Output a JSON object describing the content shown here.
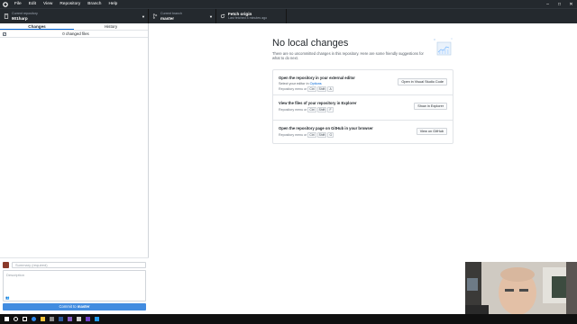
{
  "menu": {
    "items": [
      "File",
      "Edit",
      "View",
      "Repository",
      "Branch",
      "Help"
    ]
  },
  "toolbar": {
    "repo_label": "Current repository",
    "repo_value": "901harp",
    "branch_label": "Current branch",
    "branch_value": "master",
    "fetch_label": "Fetch origin",
    "fetch_sub": "Last fetched 4 minutes ago"
  },
  "sidebar": {
    "tabs": [
      "Changes",
      "History"
    ],
    "changed_files": "0 changed files",
    "summary_placeholder": "Summary (required)",
    "description_placeholder": "Description",
    "commit_prefix": "Commit to",
    "commit_branch": "master"
  },
  "main": {
    "heading": "No local changes",
    "subtext": "There are no uncommitted changes in this repository. Here are some friendly suggestions for what to do next.",
    "cards": [
      {
        "title": "Open the repository in your external editor",
        "desc_prefix": "Select your editor in",
        "desc_link": "Options",
        "shortcut_prefix": "Repository menu or",
        "keys": [
          "Ctrl",
          "Shift",
          "A"
        ],
        "button": "Open in Visual Studio Code"
      },
      {
        "title": "View the files of your repository in Explorer",
        "shortcut_prefix": "Repository menu or",
        "keys": [
          "Ctrl",
          "Shift",
          "F"
        ],
        "button": "Show in Explorer"
      },
      {
        "title": "Open the repository page on GitHub in your browser",
        "shortcut_prefix": "Repository menu or",
        "keys": [
          "Ctrl",
          "Shift",
          "G"
        ],
        "button": "View on GitHub"
      }
    ]
  },
  "colors": {
    "dark_bar": "#24292e",
    "accent": "#0366d6",
    "taskbar": "#101010"
  },
  "taskbar_icons": [
    "windows-start-icon",
    "search-icon",
    "task-view-icon",
    "edge-icon",
    "file-explorer-icon",
    "store-icon",
    "mail-icon",
    "visual-studio-icon",
    "terminal-icon",
    "github-desktop-icon",
    "vscode-icon"
  ]
}
